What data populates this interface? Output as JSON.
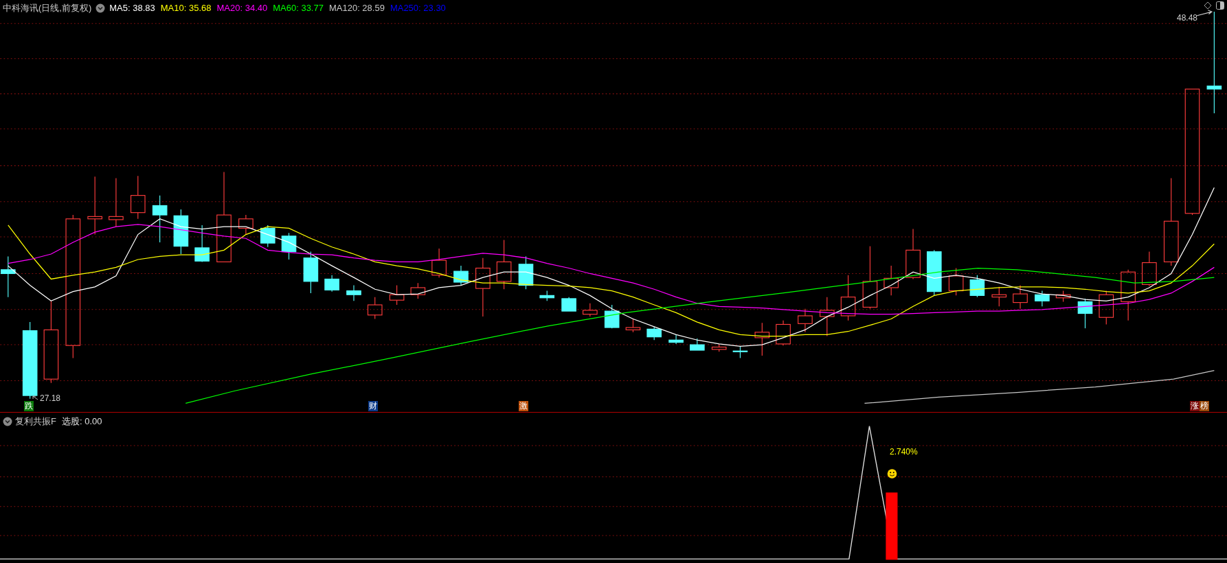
{
  "header": {
    "title": "中科海讯(日线,前复权)",
    "indicators": [
      {
        "label": "MA5: 38.83",
        "color": "#ffffff"
      },
      {
        "label": "MA10: 35.68",
        "color": "#ffff00"
      },
      {
        "label": "MA20: 34.40",
        "color": "#ff00ff"
      },
      {
        "label": "MA60: 33.77",
        "color": "#00ff00"
      },
      {
        "label": "MA120: 28.59",
        "color": "#c8c8c8"
      },
      {
        "label": "MA250: 23.30",
        "color": "#0000ff"
      }
    ]
  },
  "high_label": "48.48",
  "low_label": "27.18",
  "event_markers": [
    {
      "parts": [
        {
          "text": "跌",
          "color": "#0a7a0a"
        }
      ]
    },
    {
      "parts": [
        {
          "text": "财",
          "color": "#0a3a8a"
        }
      ]
    },
    {
      "parts": [
        {
          "text": "激",
          "color": "#c0500a"
        }
      ]
    },
    {
      "parts": [
        {
          "text": "涨",
          "color": "#7a0a0a"
        },
        {
          "text": "榜",
          "color": "#9a4a0a"
        }
      ]
    }
  ],
  "indicator_panel": {
    "name": "复利共振F",
    "reading": "选股: 0.00",
    "annotation": "2.740%"
  }
}
